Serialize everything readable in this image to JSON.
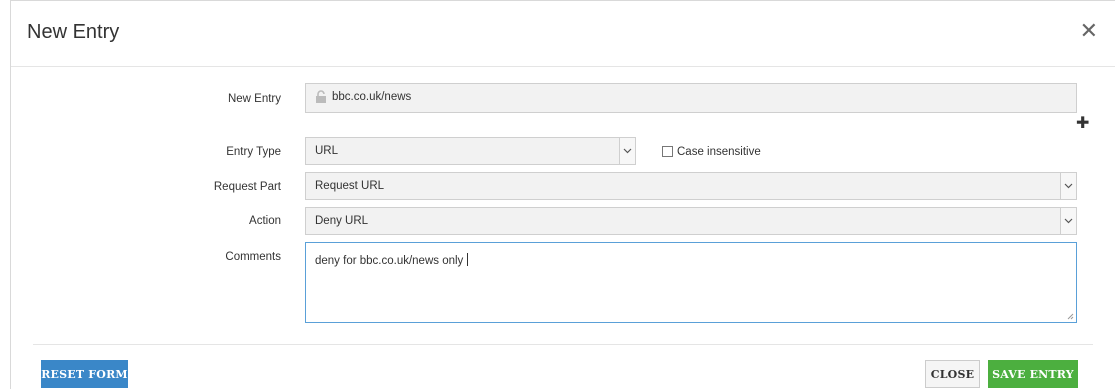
{
  "dialog": {
    "title": "New Entry",
    "close_icon": "close-icon"
  },
  "form": {
    "new_entry": {
      "label": "New Entry",
      "value": "bbc.co.uk/news",
      "icon": "unlock-icon"
    },
    "add_icon": "plus-icon",
    "entry_type": {
      "label": "Entry Type",
      "value": "URL"
    },
    "case_insensitive": {
      "label": "Case insensitive",
      "checked": false
    },
    "request_part": {
      "label": "Request Part",
      "value": "Request URL"
    },
    "action": {
      "label": "Action",
      "value": "Deny URL"
    },
    "comments": {
      "label": "Comments",
      "value": "deny for bbc.co.uk/news only"
    }
  },
  "footer": {
    "reset_label": "RESET FORM",
    "close_label": "CLOSE",
    "save_label": "SAVE ENTRY"
  },
  "colors": {
    "reset_button": "#3a87c8",
    "save_button": "#4caf3f",
    "focus_border": "#5aa0d8"
  }
}
